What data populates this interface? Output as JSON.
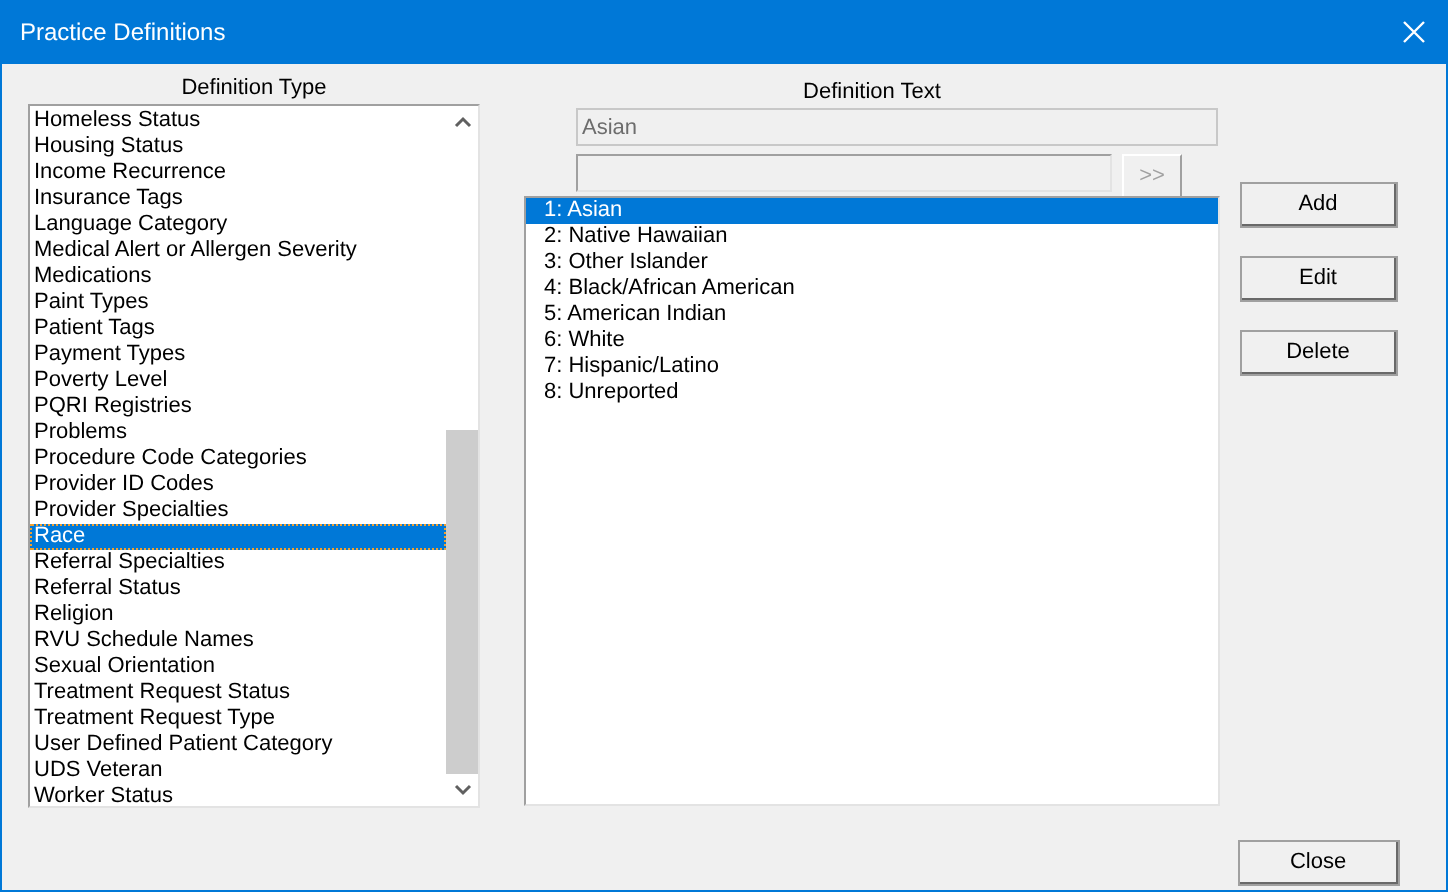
{
  "window": {
    "title": "Practice Definitions"
  },
  "definition_type": {
    "label": "Definition Type",
    "items": [
      {
        "label": "Homeless Status",
        "selected": false
      },
      {
        "label": "Housing Status",
        "selected": false
      },
      {
        "label": "Income Recurrence",
        "selected": false
      },
      {
        "label": "Insurance Tags",
        "selected": false
      },
      {
        "label": "Language Category",
        "selected": false
      },
      {
        "label": "Medical Alert or Allergen Severity",
        "selected": false
      },
      {
        "label": "Medications",
        "selected": false
      },
      {
        "label": "Paint Types",
        "selected": false
      },
      {
        "label": "Patient Tags",
        "selected": false
      },
      {
        "label": "Payment Types",
        "selected": false
      },
      {
        "label": "Poverty Level",
        "selected": false
      },
      {
        "label": "PQRI Registries",
        "selected": false
      },
      {
        "label": "Problems",
        "selected": false
      },
      {
        "label": "Procedure Code Categories",
        "selected": false
      },
      {
        "label": "Provider ID Codes",
        "selected": false
      },
      {
        "label": "Provider Specialties",
        "selected": false
      },
      {
        "label": "Race",
        "selected": true
      },
      {
        "label": "Referral Specialties",
        "selected": false
      },
      {
        "label": "Referral Status",
        "selected": false
      },
      {
        "label": "Religion",
        "selected": false
      },
      {
        "label": "RVU Schedule Names",
        "selected": false
      },
      {
        "label": "Sexual Orientation",
        "selected": false
      },
      {
        "label": "Treatment Request Status",
        "selected": false
      },
      {
        "label": "Treatment Request Type",
        "selected": false
      },
      {
        "label": "User Defined Patient Category",
        "selected": false
      },
      {
        "label": "UDS Veteran",
        "selected": false
      },
      {
        "label": "Worker Status",
        "selected": false
      }
    ]
  },
  "definition_text": {
    "label": "Definition Text",
    "value": "Asian",
    "move_button": ">>",
    "items": [
      {
        "label": "1: Asian",
        "selected": true
      },
      {
        "label": "2: Native Hawaiian",
        "selected": false
      },
      {
        "label": "3: Other Islander",
        "selected": false
      },
      {
        "label": "4: Black/African American",
        "selected": false
      },
      {
        "label": "5: American Indian",
        "selected": false
      },
      {
        "label": "6: White",
        "selected": false
      },
      {
        "label": "7: Hispanic/Latino",
        "selected": false
      },
      {
        "label": "8: Unreported",
        "selected": false
      }
    ]
  },
  "buttons": [
    "Add",
    "Edit",
    "Delete"
  ],
  "close_button": "Close"
}
